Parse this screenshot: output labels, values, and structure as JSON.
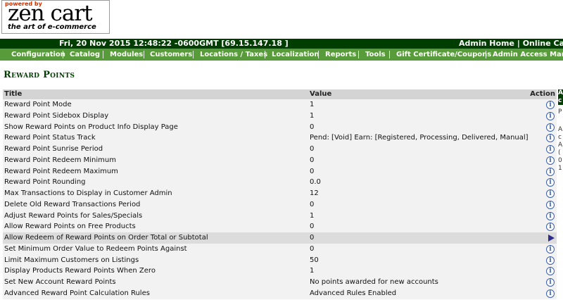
{
  "logo": {
    "powered_by": "powered by",
    "brand": "zen cart",
    "tagline": "the art of e-commerce"
  },
  "header": {
    "datetime": "Fri, 20 Nov 2015 12:48:22 -0600GMT [69.15.147.18 ]",
    "admin_home": "Admin Home",
    "separator": "|",
    "online_catalog": "Online Catalog"
  },
  "menu": [
    "Configuration",
    "Catalog",
    "Modules",
    "Customers",
    "Locations / Taxes",
    "Localization",
    "Reports",
    "Tools",
    "Gift Certificate/Coupons",
    "Admin Access Management"
  ],
  "page_title": "Reward Points",
  "table": {
    "headers": {
      "title": "Title",
      "value": "Value",
      "action": "Action"
    },
    "rows": [
      {
        "title": "Reward Point Mode",
        "value": "1",
        "action": "info-icon"
      },
      {
        "title": "Reward Point Sidebox Display",
        "value": "1",
        "action": "info-icon"
      },
      {
        "title": "Show Reward Points on Product Info Display Page",
        "value": "0",
        "action": "info-icon"
      },
      {
        "title": "Reward Point Status Track",
        "value": "Pend: [Void] Earn: [Registered, Processing, Delivered, Manual]",
        "action": "info-icon"
      },
      {
        "title": "Reward Point Sunrise Period",
        "value": "0",
        "action": "info-icon"
      },
      {
        "title": "Reward Point Redeem Minimum",
        "value": "0",
        "action": "info-icon"
      },
      {
        "title": "Reward Point Redeem Maximum",
        "value": "0",
        "action": "info-icon"
      },
      {
        "title": "Reward Point Rounding",
        "value": "0.0",
        "action": "info-icon"
      },
      {
        "title": "Max Transactions to Display in Customer Admin",
        "value": "12",
        "action": "info-icon"
      },
      {
        "title": "Delete Old Reward Transactions Period",
        "value": "0",
        "action": "info-icon"
      },
      {
        "title": "Adjust Reward Points for Sales/Specials",
        "value": "1",
        "action": "info-icon"
      },
      {
        "title": "Allow Reward Points on Free Products",
        "value": "0",
        "action": "info-icon"
      },
      {
        "title": "Allow Redeem of Reward Points on Order Total or Subtotal",
        "value": "0",
        "action": "arrow-icon",
        "selected": true
      },
      {
        "title": "Set Minimum Order Value to Redeem Points Against",
        "value": "0",
        "action": "info-icon"
      },
      {
        "title": "Limit Maximum Customers on Listings",
        "value": "50",
        "action": "info-icon"
      },
      {
        "title": "Display Products Reward Points When Zero",
        "value": "1",
        "action": "info-icon"
      },
      {
        "title": "Set New Account Reward Points",
        "value": "No points awarded for new accounts",
        "action": "info-icon"
      },
      {
        "title": "Advanced Reward Point Calculation Rules",
        "value": "Advanced Rules Enabled",
        "action": "info-icon"
      }
    ]
  },
  "side_panel": {
    "header_chars": [
      "A",
      "c"
    ],
    "text_chars": [
      "P",
      "A",
      "c",
      "A",
      "(",
      "0",
      "1"
    ]
  },
  "colors": {
    "header_bg": "#003d00",
    "menu_bg": "#589b3a",
    "title_color": "#003d00",
    "info_icon": "#3a5fb0",
    "arrow_icon": "#2d2d8c"
  }
}
